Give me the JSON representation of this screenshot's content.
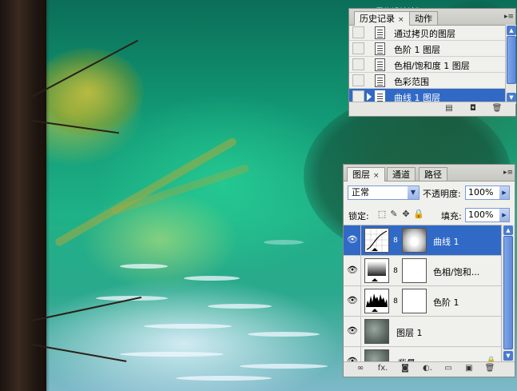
{
  "watermark": "思缘设计论坛 www.MISSYUAN.COM",
  "history_panel": {
    "tabs": [
      {
        "label": "历史记录",
        "active": true
      },
      {
        "label": "动作",
        "active": false
      }
    ],
    "close_glyph": "×",
    "menu_glyph": "▸≡",
    "items": [
      {
        "label": "通过拷贝的图层",
        "selected": false
      },
      {
        "label": "色阶 1 图层",
        "selected": false
      },
      {
        "label": "色相/饱和度 1 图层",
        "selected": false
      },
      {
        "label": "色彩范围",
        "selected": false
      },
      {
        "label": "曲线 1 图层",
        "selected": true
      }
    ],
    "scroll_up": "▲",
    "scroll_down": "▼",
    "footer_icons": [
      "new-document-from-state-icon",
      "camera-snapshot-icon",
      "trash-icon"
    ],
    "footer_glyphs": [
      "▤",
      "◘",
      "🗑"
    ]
  },
  "layers_panel": {
    "tabs": [
      {
        "label": "图层",
        "active": true
      },
      {
        "label": "通道",
        "active": false
      },
      {
        "label": "路径",
        "active": false
      }
    ],
    "close_glyph": "×",
    "menu_glyph": "▸≡",
    "blend_mode": "正常",
    "opacity_label": "不透明度:",
    "opacity_value": "100%",
    "lock_label": "锁定:",
    "lock_glyphs": [
      "⬚",
      "✎",
      "✥",
      "🔒"
    ],
    "fill_label": "填充:",
    "fill_value": "100%",
    "dropdown_glyph": "▼",
    "stepper_glyph": "▶",
    "layers": [
      {
        "name": "曲线 1",
        "type": "curves",
        "visible": true,
        "selected": true
      },
      {
        "name": "色相/饱和...",
        "type": "hue-saturation",
        "visible": true,
        "selected": false
      },
      {
        "name": "色阶 1",
        "type": "levels",
        "visible": true,
        "selected": false
      },
      {
        "name": "图层 1",
        "type": "pixel",
        "visible": true,
        "selected": false
      },
      {
        "name": "背景",
        "type": "background",
        "visible": true,
        "selected": false
      }
    ],
    "eye_glyph": "👁",
    "chain_glyph": "8",
    "background_lock_glyph": "🔒",
    "scroll_up": "▲",
    "scroll_down": "▼",
    "footer_glyphs": [
      "∞",
      "fx.",
      "◙",
      "◐.",
      "▭",
      "▣",
      "🗑"
    ],
    "footer_icons": [
      "link-layers-icon",
      "fx-icon",
      "add-mask-icon",
      "adjustment-layer-icon",
      "group-folder-icon",
      "new-layer-icon",
      "trash-icon"
    ]
  },
  "colors": {
    "selection": "#3169c6",
    "panel_bg": "#f0f0ec"
  }
}
